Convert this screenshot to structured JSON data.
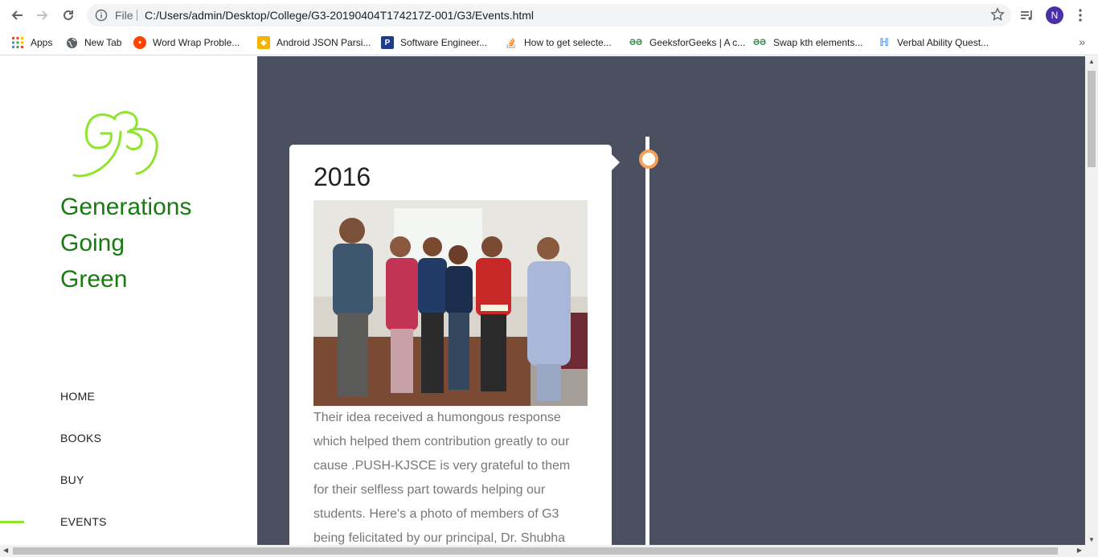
{
  "browser": {
    "file_label": "File",
    "url": "C:/Users/admin/Desktop/College/G3-20190404T174217Z-001/G3/Events.html",
    "profile_initial": "N"
  },
  "bookmarks": [
    {
      "label": "Apps",
      "icon": "apps-grid-icon",
      "color": "#e94235"
    },
    {
      "label": "New Tab",
      "icon": "globe-icon",
      "color": "#5f6368"
    },
    {
      "label": "Word Wrap Proble...",
      "icon": "reddit-icon",
      "color": "#ff4500"
    },
    {
      "label": "Android JSON Parsi...",
      "icon": "android-icon",
      "color": "#f4b400"
    },
    {
      "label": "Software Engineer...",
      "icon": "p-icon",
      "color": "#1f3c88"
    },
    {
      "label": "How to get selecte...",
      "icon": "stackoverflow-icon",
      "color": "#f48024"
    },
    {
      "label": "GeeksforGeeks | A c...",
      "icon": "gfg-icon",
      "color": "#2f8d46"
    },
    {
      "label": "Swap kth elements...",
      "icon": "gfg-icon",
      "color": "#2f8d46"
    },
    {
      "label": "Verbal Ability Quest...",
      "icon": "indiabix-icon",
      "color": "#1a73e8"
    }
  ],
  "site": {
    "brand_lines": [
      "Generations",
      "Going",
      "Green"
    ],
    "brand_color": "#1a7a12",
    "accent_color": "#8ee52c",
    "menu": [
      "HOME",
      "BOOKS",
      "BUY",
      "EVENTS"
    ],
    "active_menu": "EVENTS"
  },
  "event": {
    "year": "2016",
    "text": "Their idea received a humongous response which helped them contribution greatly to our cause .PUSH-KJSCE is very grateful to them for their selfless part towards helping our students. Here's a photo of members of G3 being felicitated by our principal, Dr. Shubha"
  },
  "colors": {
    "content_bg": "#4a5060",
    "timeline_dot": "#f5a15a"
  }
}
